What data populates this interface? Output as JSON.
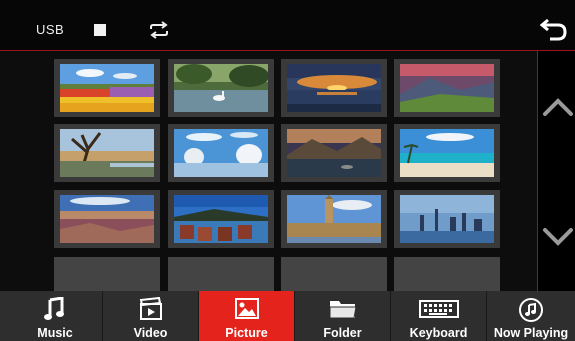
{
  "topbar": {
    "source_label": "USB",
    "icons": [
      "stop-icon",
      "repeat-icon",
      "back-icon"
    ]
  },
  "gallery": {
    "thumbnails": [
      {
        "subject": "tulip-field"
      },
      {
        "subject": "swan-lake"
      },
      {
        "subject": "sunset-sea"
      },
      {
        "subject": "mountain-sunset"
      },
      {
        "subject": "tree-river"
      },
      {
        "subject": "snow-trees"
      },
      {
        "subject": "lake-mountains"
      },
      {
        "subject": "tropical-beach"
      },
      {
        "subject": "canyon"
      },
      {
        "subject": "boats-dock"
      },
      {
        "subject": "big-ben-london"
      },
      {
        "subject": "city-skyline"
      },
      {
        "subject": "empty"
      },
      {
        "subject": "empty"
      },
      {
        "subject": "empty"
      },
      {
        "subject": "empty"
      }
    ],
    "scroll_icons": [
      "chevron-up-icon",
      "chevron-down-icon"
    ]
  },
  "bottombar": {
    "items": [
      {
        "label": "Music",
        "icon": "music-note-icon",
        "active": false
      },
      {
        "label": "Video",
        "icon": "video-icon",
        "active": false
      },
      {
        "label": "Picture",
        "icon": "picture-icon",
        "active": true
      },
      {
        "label": "Folder",
        "icon": "folder-icon",
        "active": false
      },
      {
        "label": "Keyboard",
        "icon": "keyboard-icon",
        "active": false
      },
      {
        "label": "Now Playing",
        "icon": "now-playing-icon",
        "active": false
      }
    ]
  },
  "colors": {
    "accent": "#e5231d",
    "divider": "#9b1418",
    "bar_bg": "#2e2e2e"
  }
}
